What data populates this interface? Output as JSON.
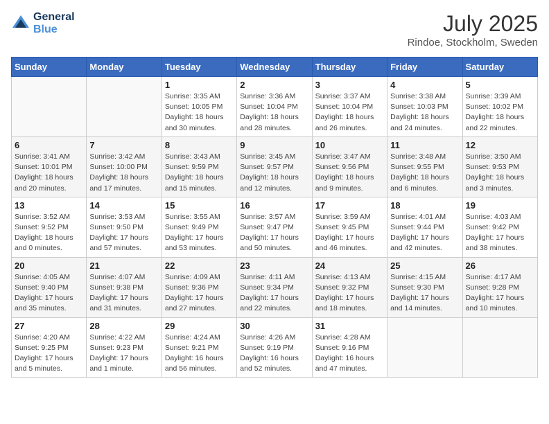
{
  "header": {
    "logo_line1": "General",
    "logo_line2": "Blue",
    "month_year": "July 2025",
    "location": "Rindoe, Stockholm, Sweden"
  },
  "weekdays": [
    "Sunday",
    "Monday",
    "Tuesday",
    "Wednesday",
    "Thursday",
    "Friday",
    "Saturday"
  ],
  "weeks": [
    [
      {
        "day": "",
        "info": ""
      },
      {
        "day": "",
        "info": ""
      },
      {
        "day": "1",
        "info": "Sunrise: 3:35 AM\nSunset: 10:05 PM\nDaylight: 18 hours and 30 minutes."
      },
      {
        "day": "2",
        "info": "Sunrise: 3:36 AM\nSunset: 10:04 PM\nDaylight: 18 hours and 28 minutes."
      },
      {
        "day": "3",
        "info": "Sunrise: 3:37 AM\nSunset: 10:04 PM\nDaylight: 18 hours and 26 minutes."
      },
      {
        "day": "4",
        "info": "Sunrise: 3:38 AM\nSunset: 10:03 PM\nDaylight: 18 hours and 24 minutes."
      },
      {
        "day": "5",
        "info": "Sunrise: 3:39 AM\nSunset: 10:02 PM\nDaylight: 18 hours and 22 minutes."
      }
    ],
    [
      {
        "day": "6",
        "info": "Sunrise: 3:41 AM\nSunset: 10:01 PM\nDaylight: 18 hours and 20 minutes."
      },
      {
        "day": "7",
        "info": "Sunrise: 3:42 AM\nSunset: 10:00 PM\nDaylight: 18 hours and 17 minutes."
      },
      {
        "day": "8",
        "info": "Sunrise: 3:43 AM\nSunset: 9:59 PM\nDaylight: 18 hours and 15 minutes."
      },
      {
        "day": "9",
        "info": "Sunrise: 3:45 AM\nSunset: 9:57 PM\nDaylight: 18 hours and 12 minutes."
      },
      {
        "day": "10",
        "info": "Sunrise: 3:47 AM\nSunset: 9:56 PM\nDaylight: 18 hours and 9 minutes."
      },
      {
        "day": "11",
        "info": "Sunrise: 3:48 AM\nSunset: 9:55 PM\nDaylight: 18 hours and 6 minutes."
      },
      {
        "day": "12",
        "info": "Sunrise: 3:50 AM\nSunset: 9:53 PM\nDaylight: 18 hours and 3 minutes."
      }
    ],
    [
      {
        "day": "13",
        "info": "Sunrise: 3:52 AM\nSunset: 9:52 PM\nDaylight: 18 hours and 0 minutes."
      },
      {
        "day": "14",
        "info": "Sunrise: 3:53 AM\nSunset: 9:50 PM\nDaylight: 17 hours and 57 minutes."
      },
      {
        "day": "15",
        "info": "Sunrise: 3:55 AM\nSunset: 9:49 PM\nDaylight: 17 hours and 53 minutes."
      },
      {
        "day": "16",
        "info": "Sunrise: 3:57 AM\nSunset: 9:47 PM\nDaylight: 17 hours and 50 minutes."
      },
      {
        "day": "17",
        "info": "Sunrise: 3:59 AM\nSunset: 9:45 PM\nDaylight: 17 hours and 46 minutes."
      },
      {
        "day": "18",
        "info": "Sunrise: 4:01 AM\nSunset: 9:44 PM\nDaylight: 17 hours and 42 minutes."
      },
      {
        "day": "19",
        "info": "Sunrise: 4:03 AM\nSunset: 9:42 PM\nDaylight: 17 hours and 38 minutes."
      }
    ],
    [
      {
        "day": "20",
        "info": "Sunrise: 4:05 AM\nSunset: 9:40 PM\nDaylight: 17 hours and 35 minutes."
      },
      {
        "day": "21",
        "info": "Sunrise: 4:07 AM\nSunset: 9:38 PM\nDaylight: 17 hours and 31 minutes."
      },
      {
        "day": "22",
        "info": "Sunrise: 4:09 AM\nSunset: 9:36 PM\nDaylight: 17 hours and 27 minutes."
      },
      {
        "day": "23",
        "info": "Sunrise: 4:11 AM\nSunset: 9:34 PM\nDaylight: 17 hours and 22 minutes."
      },
      {
        "day": "24",
        "info": "Sunrise: 4:13 AM\nSunset: 9:32 PM\nDaylight: 17 hours and 18 minutes."
      },
      {
        "day": "25",
        "info": "Sunrise: 4:15 AM\nSunset: 9:30 PM\nDaylight: 17 hours and 14 minutes."
      },
      {
        "day": "26",
        "info": "Sunrise: 4:17 AM\nSunset: 9:28 PM\nDaylight: 17 hours and 10 minutes."
      }
    ],
    [
      {
        "day": "27",
        "info": "Sunrise: 4:20 AM\nSunset: 9:25 PM\nDaylight: 17 hours and 5 minutes."
      },
      {
        "day": "28",
        "info": "Sunrise: 4:22 AM\nSunset: 9:23 PM\nDaylight: 17 hours and 1 minute."
      },
      {
        "day": "29",
        "info": "Sunrise: 4:24 AM\nSunset: 9:21 PM\nDaylight: 16 hours and 56 minutes."
      },
      {
        "day": "30",
        "info": "Sunrise: 4:26 AM\nSunset: 9:19 PM\nDaylight: 16 hours and 52 minutes."
      },
      {
        "day": "31",
        "info": "Sunrise: 4:28 AM\nSunset: 9:16 PM\nDaylight: 16 hours and 47 minutes."
      },
      {
        "day": "",
        "info": ""
      },
      {
        "day": "",
        "info": ""
      }
    ]
  ]
}
